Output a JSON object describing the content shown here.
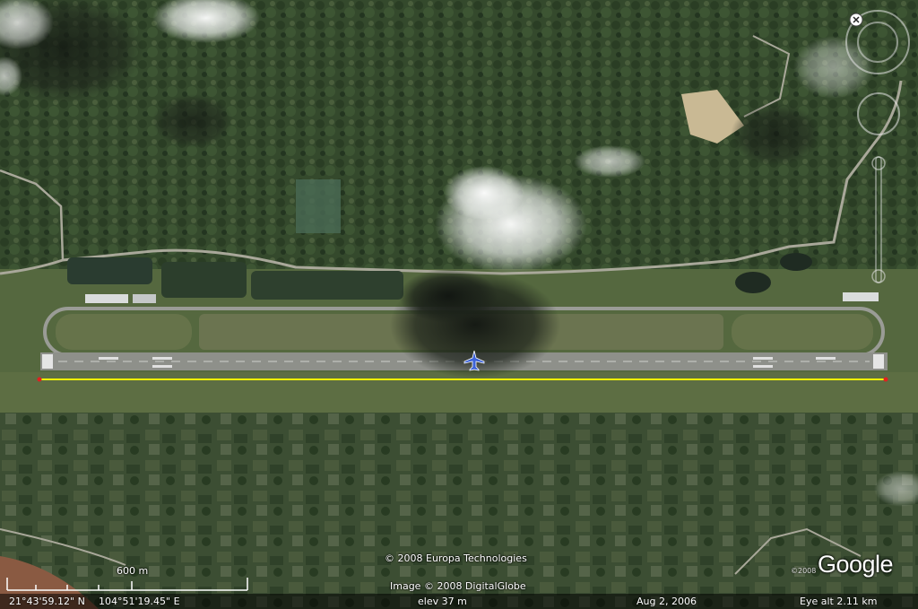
{
  "map": {
    "credits": {
      "line1": "© 2008 Europa Technologies",
      "line2": "Image © 2008 DigitalGlobe"
    },
    "scale_bar": {
      "label": "600 m"
    },
    "status": {
      "latitude": "21°43'59.12\" N",
      "longitude": "104°51'19.45\" E",
      "elevation": "elev   37 m",
      "date": "Aug  2, 2006",
      "eye_altitude": "Eye alt    2.11 km"
    },
    "logo": {
      "text": "Google",
      "copyright": "©2008"
    },
    "icons": [
      "airport-icon",
      "north-arrow-icon",
      "look-control-icon",
      "move-control-icon",
      "zoom-slider-icon"
    ],
    "colors": {
      "measure_line": "#f4f400",
      "runway": "#8e908a",
      "vegetation": "#3a4f30"
    }
  }
}
